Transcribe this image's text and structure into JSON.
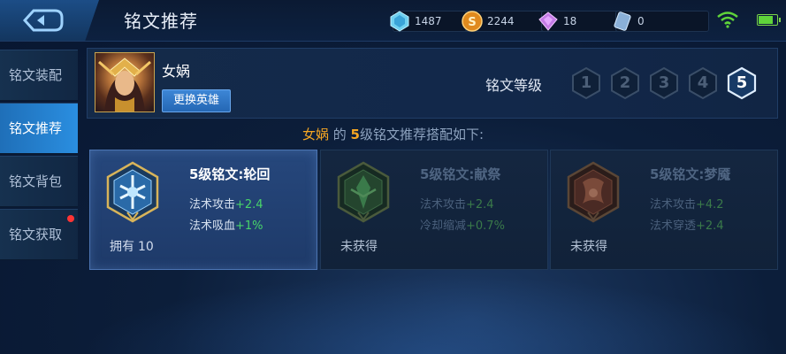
{
  "header": {
    "title": "铭文推荐",
    "currencies": [
      {
        "icon": "crystal-icon",
        "value": "1487"
      },
      {
        "icon": "gold-coin-icon",
        "value": "2244"
      },
      {
        "icon": "diamond-icon",
        "value": "18"
      },
      {
        "icon": "ticket-icon",
        "value": "0"
      }
    ],
    "battery_level": 0.8
  },
  "sidebar": {
    "items": [
      {
        "label": "铭文装配",
        "active": false,
        "badge": false
      },
      {
        "label": "铭文推荐",
        "active": true,
        "badge": false
      },
      {
        "label": "铭文背包",
        "active": false,
        "badge": false
      },
      {
        "label": "铭文获取",
        "active": false,
        "badge": true
      }
    ]
  },
  "hero": {
    "name": "女娲",
    "change_button": "更换英雄"
  },
  "levels": {
    "label": "铭文等级",
    "options": [
      "1",
      "2",
      "3",
      "4",
      "5"
    ],
    "selected": "5"
  },
  "recommendation": {
    "hero": "女娲",
    "connector": "的",
    "level": "5",
    "suffix": "级铭文推荐搭配如下:"
  },
  "cards": [
    {
      "title": "5级铭文:轮回",
      "attrs": [
        {
          "name": "法术攻击",
          "value": "+2.4"
        },
        {
          "name": "法术吸血",
          "value": "+1%"
        }
      ],
      "status": "拥有",
      "count": "10",
      "color": "#4fb0e8"
    },
    {
      "title": "5级铭文:献祭",
      "attrs": [
        {
          "name": "法术攻击",
          "value": "+2.4"
        },
        {
          "name": "冷却缩减",
          "value": "+0.7%"
        }
      ],
      "status": "未获得",
      "count": "",
      "color": "#3f8a4a"
    },
    {
      "title": "5级铭文:梦魇",
      "attrs": [
        {
          "name": "法术攻击",
          "value": "+4.2"
        },
        {
          "name": "法术穿透",
          "value": "+2.4"
        }
      ],
      "status": "未获得",
      "count": "",
      "color": "#8a4a3a"
    }
  ]
}
